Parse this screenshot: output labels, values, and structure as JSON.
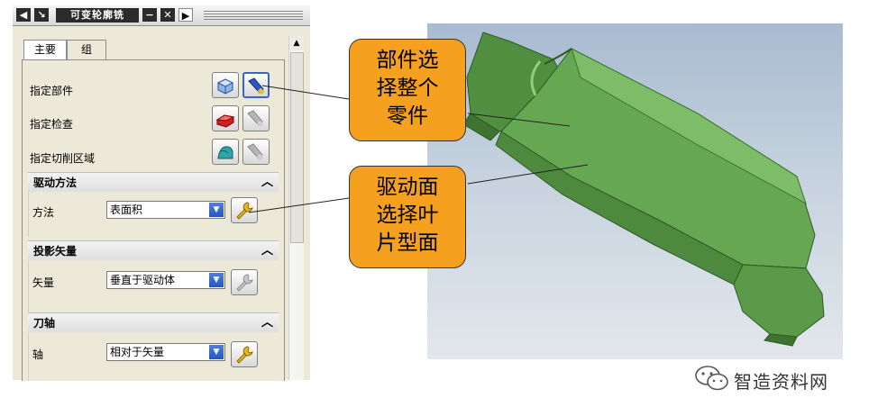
{
  "dialog": {
    "title": "可变轮廓铣",
    "title_buttons": {
      "minimize": "−",
      "close": "✕",
      "next": "▶",
      "back": "◀",
      "pin": "↘"
    },
    "tabs": [
      {
        "label": "主要"
      },
      {
        "label": "组"
      }
    ],
    "rows": {
      "part": {
        "label": "指定部件"
      },
      "check": {
        "label": "指定检查"
      },
      "cut_area": {
        "label": "指定切削区域"
      }
    },
    "sections": {
      "drive": {
        "title": "驱动方法",
        "field_label": "方法",
        "value": "表面积"
      },
      "projection": {
        "title": "投影矢量",
        "field_label": "矢量",
        "value": "垂直于驱动体"
      },
      "tool_axis": {
        "title": "刀轴",
        "field_label": "轴",
        "value": "相对于矢量"
      }
    }
  },
  "callouts": {
    "part": [
      "部件选",
      "择整个",
      "零件"
    ],
    "drive_surface": [
      "驱动面",
      "选择叶",
      "片型面"
    ]
  },
  "watermark": {
    "text": "智造资料网",
    "icon": "wechat-icon"
  },
  "colors": {
    "callout": "#f5a11f",
    "part_green": "#5a9a4a",
    "selected_blue": "#3a62c8"
  }
}
